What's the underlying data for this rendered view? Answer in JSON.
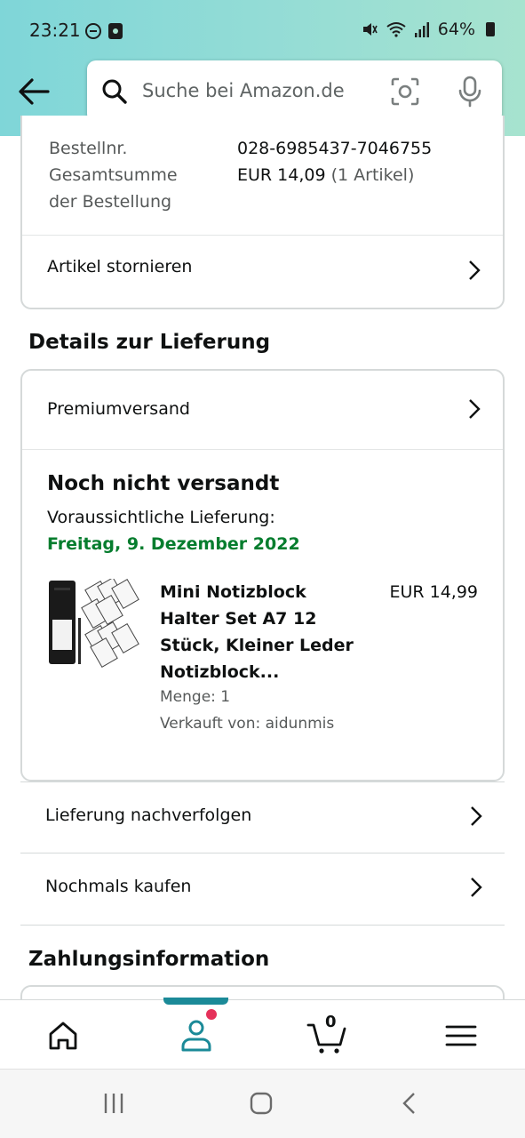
{
  "status_bar": {
    "time": "23:21",
    "battery": "64%",
    "icons": [
      "do-not-disturb-icon",
      "sim-icon",
      "mute-icon",
      "wifi-icon",
      "signal-icon",
      "battery-icon"
    ]
  },
  "search": {
    "placeholder": "Suche bei Amazon.de"
  },
  "order_summary": {
    "order_number_label": "Bestellnr.",
    "order_number": "028-6985437-7046755",
    "total_label_line1": "Gesamtsumme",
    "total_label_line2": "der Bestellung",
    "total_value": "EUR 14,09",
    "total_items": "(1 Artikel)",
    "cancel_label": "Artikel stornieren"
  },
  "delivery": {
    "section_title": "Details zur Lieferung",
    "shipping_method": "Premiumversand",
    "status": "Noch nicht versandt",
    "eta_label": "Voraussichtliche Lieferung:",
    "eta_date": "Freitag, 9. Dezember 2022",
    "product": {
      "title_lines": [
        "Mini Notizblock",
        "Halter Set A7 12",
        "Stück, Kleiner Leder",
        "Notizblock..."
      ],
      "price": "EUR 14,99",
      "quantity": "Menge: 1",
      "seller": "Verkauft von: aidunmis"
    }
  },
  "actions": {
    "track": "Lieferung nachverfolgen",
    "buy_again": "Nochmals kaufen"
  },
  "payment": {
    "section_title": "Zahlungsinformation"
  },
  "bottom_nav": {
    "cart_count": "0",
    "active_tab": "account",
    "colors": {
      "accent": "#1b8a98",
      "badge": "#e5315a"
    }
  },
  "colors": {
    "delivery_green": "#067d2e",
    "text": "#0f1111",
    "muted": "#565959",
    "border": "#d5d9d9"
  }
}
